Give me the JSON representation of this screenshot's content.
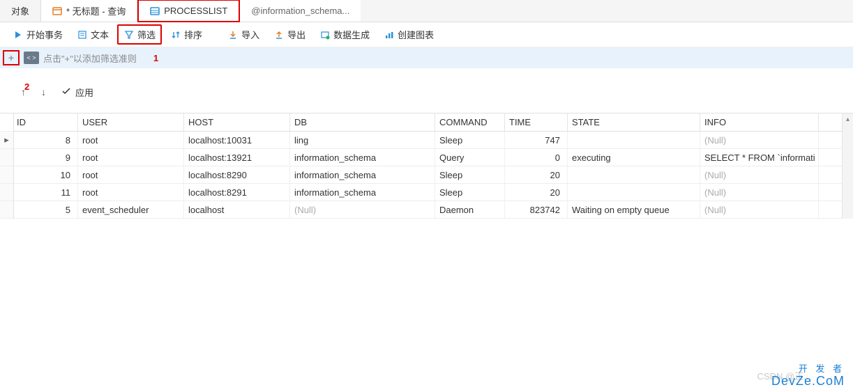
{
  "tabs": {
    "objects": "对象",
    "untitled": "* 无标题 - 查询",
    "processlist": "PROCESSLIST",
    "processlist_suffix": "@information_schema..."
  },
  "toolbar": {
    "begin_tx": "开始事务",
    "text": "文本",
    "filter": "筛选",
    "sort": "排序",
    "import": "导入",
    "export": "导出",
    "data_gen": "数据生成",
    "chart": "创建图表"
  },
  "filter_bar": {
    "sql_badge": "< >",
    "placeholder": "点击\"+\"以添加筛选准则",
    "annot1": "1",
    "annot2": "2"
  },
  "action_bar": {
    "up": "↑",
    "down": "↓",
    "apply": "应用"
  },
  "grid": {
    "headers": {
      "id": "ID",
      "user": "USER",
      "host": "HOST",
      "db": "DB",
      "command": "COMMAND",
      "time": "TIME",
      "state": "STATE",
      "info": "INFO"
    },
    "rows": [
      {
        "id": "8",
        "user": "root",
        "host": "localhost:10031",
        "db": "ling",
        "command": "Sleep",
        "time": "747",
        "state": "",
        "info": "(Null)",
        "info_null": true,
        "db_null": false,
        "current": true
      },
      {
        "id": "9",
        "user": "root",
        "host": "localhost:13921",
        "db": "information_schema",
        "command": "Query",
        "time": "0",
        "state": "executing",
        "info": "SELECT * FROM `informati",
        "info_null": false,
        "db_null": false,
        "current": false
      },
      {
        "id": "10",
        "user": "root",
        "host": "localhost:8290",
        "db": "information_schema",
        "command": "Sleep",
        "time": "20",
        "state": "",
        "info": "(Null)",
        "info_null": true,
        "db_null": false,
        "current": false
      },
      {
        "id": "11",
        "user": "root",
        "host": "localhost:8291",
        "db": "information_schema",
        "command": "Sleep",
        "time": "20",
        "state": "",
        "info": "(Null)",
        "info_null": true,
        "db_null": false,
        "current": false
      },
      {
        "id": "5",
        "user": "event_scheduler",
        "host": "localhost",
        "db": "(Null)",
        "command": "Daemon",
        "time": "823742",
        "state": "Waiting on empty queue",
        "info": "(Null)",
        "info_null": true,
        "db_null": true,
        "current": false
      }
    ]
  },
  "watermark": "CSDN @正...",
  "logo": {
    "line1": "开 发 者",
    "line2": "DevZe.CoM"
  }
}
